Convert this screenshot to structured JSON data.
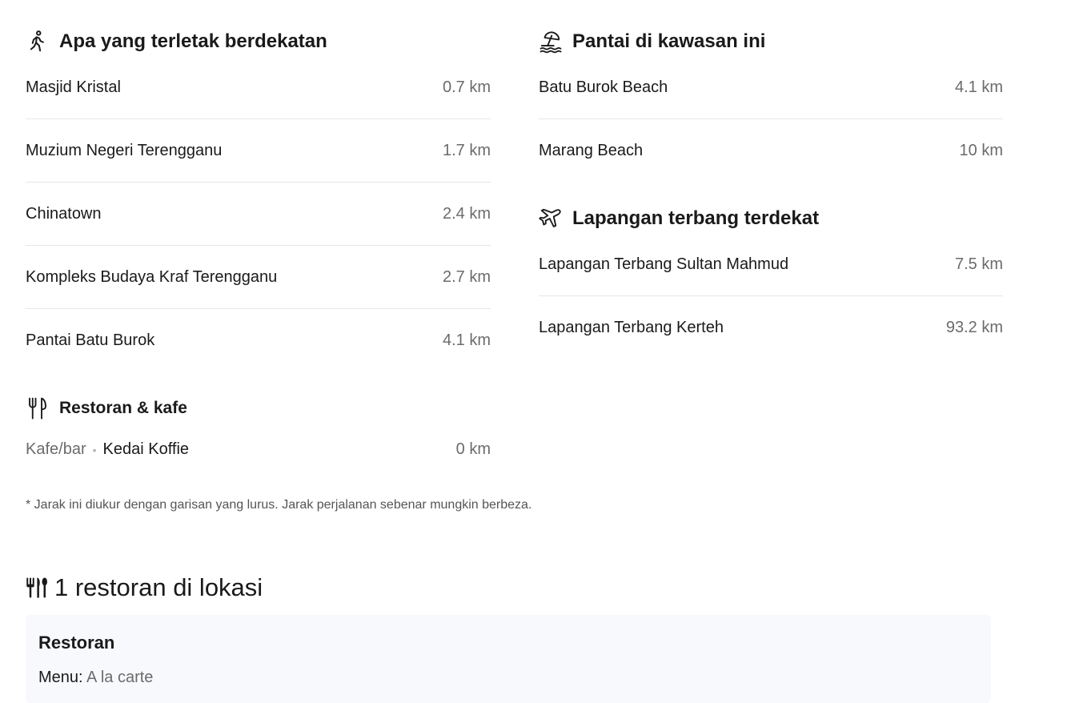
{
  "nearby": {
    "title": "Apa yang terletak berdekatan",
    "icon": "walking-person-icon",
    "items": [
      {
        "name": "Masjid Kristal",
        "distance": "0.7 km"
      },
      {
        "name": "Muzium Negeri Terengganu",
        "distance": "1.7 km"
      },
      {
        "name": "Chinatown",
        "distance": "2.4 km"
      },
      {
        "name": "Kompleks Budaya Kraf Terengganu",
        "distance": "2.7 km"
      },
      {
        "name": "Pantai Batu Burok",
        "distance": "4.1 km"
      }
    ]
  },
  "food": {
    "title": "Restoran & kafe",
    "icon": "fork-knife-icon",
    "items": [
      {
        "category": "Kafe/bar",
        "name": "Kedai Koffie",
        "distance": "0 km"
      }
    ]
  },
  "beaches": {
    "title": "Pantai di kawasan ini",
    "icon": "beach-umbrella-icon",
    "items": [
      {
        "name": "Batu Burok Beach",
        "distance": "4.1 km"
      },
      {
        "name": "Marang Beach",
        "distance": "10 km"
      }
    ]
  },
  "airports": {
    "title": "Lapangan terbang terdekat",
    "icon": "airplane-icon",
    "items": [
      {
        "name": "Lapangan Terbang Sultan Mahmud",
        "distance": "7.5 km"
      },
      {
        "name": "Lapangan Terbang Kerteh",
        "distance": "93.2 km"
      }
    ]
  },
  "note": "* Jarak ini diukur dengan garisan yang lurus. Jarak perjalanan sebenar mungkin berbeza.",
  "restaurants": {
    "heading": "1 restoran di lokasi",
    "icon": "cutlery-icon",
    "card": {
      "name": "Restoran",
      "menu_label": "Menu:",
      "menu_value": "A la carte"
    }
  }
}
